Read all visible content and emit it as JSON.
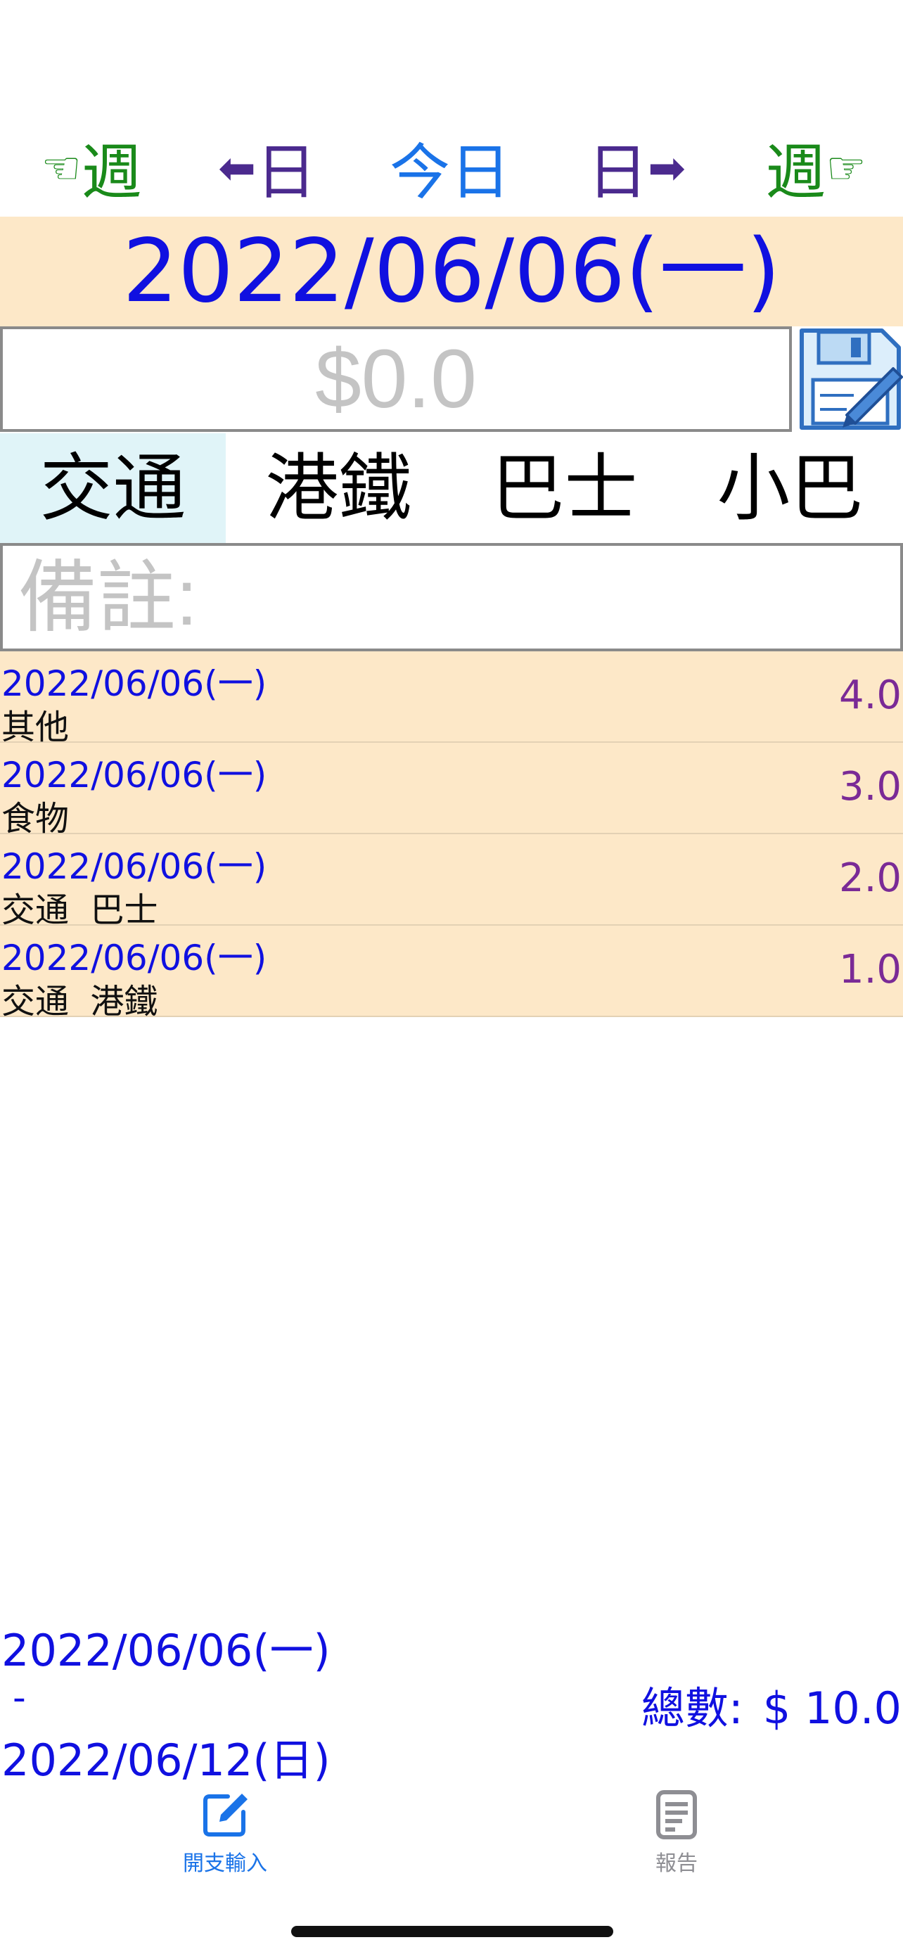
{
  "colors": {
    "week_nav": "#1a8a1a",
    "day_nav": "#4b2a8e",
    "today": "#1a73e8",
    "primary_blue": "#1010e0",
    "amount_purple": "#7a2a96",
    "header_bg": "#fde8c8",
    "category_selected_bg": "#e0f4f8",
    "tab_active": "#1a73e8",
    "tab_inactive": "#8e8e93"
  },
  "nav": {
    "prev_week": {
      "icon": "☜",
      "label": "週"
    },
    "prev_day": {
      "icon": "⬅",
      "label": "日"
    },
    "today": {
      "label": "今日"
    },
    "next_day": {
      "icon": "➡",
      "label": "日"
    },
    "next_week": {
      "icon": "☞",
      "label": "週"
    }
  },
  "current_date": "2022/06/06(一)",
  "amount": {
    "value": "",
    "placeholder": "$0.0"
  },
  "categories": [
    {
      "label": "交通",
      "selected": true
    },
    {
      "label": "港鐵",
      "selected": false
    },
    {
      "label": "巴士",
      "selected": false
    },
    {
      "label": "小巴",
      "selected": false
    }
  ],
  "remark": {
    "value": "",
    "placeholder": "備註:"
  },
  "entries": [
    {
      "date": "2022/06/06(一)",
      "category": "其他",
      "amount": "4.0"
    },
    {
      "date": "2022/06/06(一)",
      "category": "食物",
      "amount": "3.0"
    },
    {
      "date": "2022/06/06(一)",
      "category": "交通  巴士",
      "amount": "2.0"
    },
    {
      "date": "2022/06/06(一)",
      "category": "交通  港鐵",
      "amount": "1.0"
    }
  ],
  "summary": {
    "start_date": "2022/06/06(一)",
    "separator": "-",
    "end_date": "2022/06/12(日)",
    "total_label": "總數:",
    "total_value": "$ 10.0"
  },
  "tabs": [
    {
      "label": "開支輸入",
      "icon": "edit-icon",
      "active": true
    },
    {
      "label": "報告",
      "icon": "report-icon",
      "active": false
    }
  ]
}
